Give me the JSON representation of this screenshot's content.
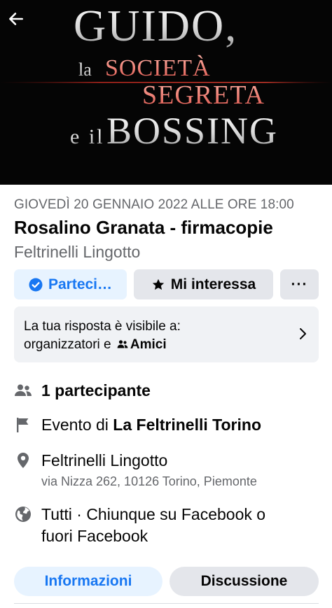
{
  "cover": {
    "title_line1": "GUIDO,",
    "title_line2_prefix": "la",
    "title_line2_main": "SOCIETÀ",
    "title_line3": "SEGRETA",
    "title_line4_prefix": "e il",
    "title_line4_main": "BOSSING",
    "back_icon": "arrow-left-icon"
  },
  "event": {
    "date": "GIOVEDÌ 20 GENNAIO 2022 ALLE ORE 18:00",
    "title": "Rosalino Granata - firmacopie",
    "venue": "Feltrinelli Lingotto"
  },
  "actions": {
    "going_label": "Parteci…",
    "interested_label": "Mi interessa",
    "more_label": "···"
  },
  "visibility": {
    "line1": "La tua risposta è visibile a:",
    "line2_prefix": "organizzatori e",
    "line2_friends": "Amici"
  },
  "details": {
    "participants": "1 partecipante",
    "event_by_prefix": "Evento di",
    "event_by_name": "La Feltrinelli Torino",
    "location_name": "Feltrinelli Lingotto",
    "location_address": "via Nizza 262, 10126 Torino, Piemonte",
    "privacy_line1": "Tutti · Chiunque su Facebook o",
    "privacy_line2": "fuori Facebook"
  },
  "tabs": {
    "info": "Informazioni",
    "discussion": "Discussione"
  },
  "colors": {
    "accent": "#1877f2",
    "accent_bg": "#e7f3ff",
    "button_bg": "#e4e6eb",
    "secondary_text": "#65676b",
    "cover_red": "#e8746a"
  }
}
